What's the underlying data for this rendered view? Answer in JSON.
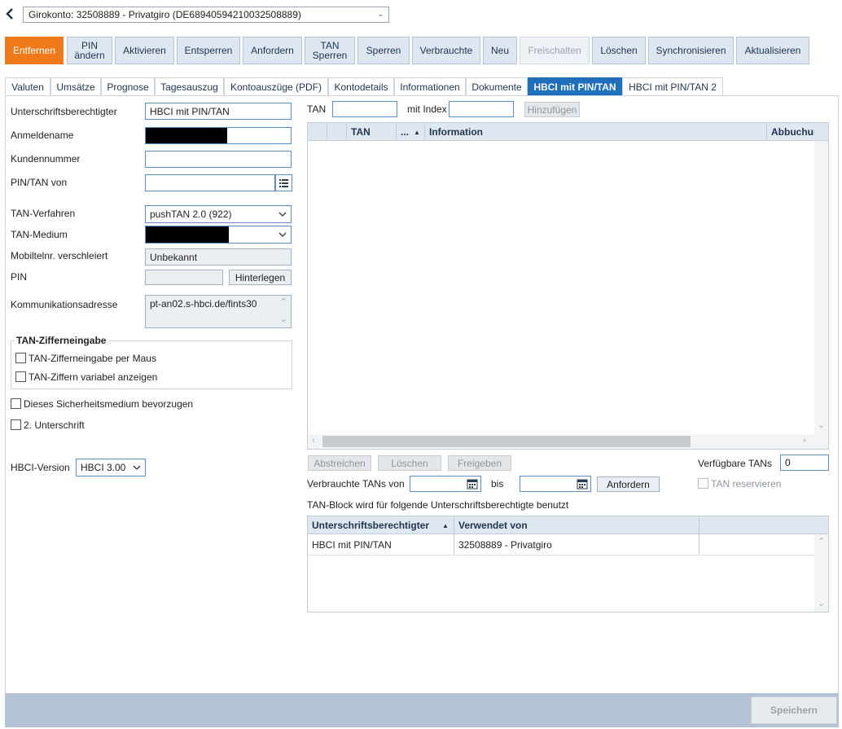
{
  "account_select": {
    "value": "Girokonto: 32508889 - Privatgiro (DE68940594210032508889)"
  },
  "toolbar": {
    "entfernen": "Entfernen",
    "pin_aendern_1": "PIN",
    "pin_aendern_2": "ändern",
    "aktivieren": "Aktivieren",
    "entsperren": "Entsperren",
    "anfordern": "Anfordern",
    "tan_sperren_1": "TAN",
    "tan_sperren_2": "Sperren",
    "sperren": "Sperren",
    "verbrauchte": "Verbrauchte",
    "neu": "Neu",
    "freischalten": "Freischalten",
    "loeschen": "Löschen",
    "synchronisieren": "Synchronisieren",
    "aktualisieren": "Aktualisieren"
  },
  "tabs": [
    "Valuten",
    "Umsätze",
    "Prognose",
    "Tagesauszug",
    "Kontoauszüge (PDF)",
    "Kontodetails",
    "Informationen",
    "Dokumente",
    "HBCI mit PIN/TAN",
    "HBCI mit PIN/TAN 2"
  ],
  "form": {
    "unterschrift_label": "Unterschriftsberechtigter",
    "unterschrift_value": "HBCI mit PIN/TAN",
    "anmeldename_label": "Anmeldename",
    "kundennummer_label": "Kundennummer",
    "pintan_von_label": "PIN/TAN von",
    "tan_verfahren_label": "TAN-Verfahren",
    "tan_verfahren_value": "pushTAN 2.0 (922)",
    "tan_medium_label": "TAN-Medium",
    "mobil_label": "Mobiltelnr. verschleiert",
    "mobil_value": "Unbekannt",
    "pin_label": "PIN",
    "hinterlegen": "Hinterlegen",
    "komm_label": "Kommunikationsadresse",
    "komm_value": "pt-an02.s-hbci.de/fints30",
    "ziffer_group": "TAN-Zifferneingabe",
    "ziffer_maus": "TAN-Zifferneingabe per Maus",
    "ziffer_variabel": "TAN-Ziffern variabel anzeigen",
    "bevorzugen": "Dieses Sicherheitsmedium bevorzugen",
    "unterschrift2": "2. Unterschrift",
    "hbci_version_label": "HBCI-Version",
    "hbci_version_value": "HBCI 3.00"
  },
  "tan_panel": {
    "tan_label": "TAN",
    "mit_index_label": "mit Index",
    "hinzufuegen": "Hinzufügen",
    "columns": [
      "TAN",
      "...",
      "Information",
      "Abbuchun"
    ],
    "abstreichen": "Abstreichen",
    "loeschen": "Löschen",
    "freigeben": "Freigeben",
    "verfuegbare_label": "Verfügbare TANs",
    "verfuegbare_value": "0",
    "verbrauchte_von_label": "Verbrauchte TANs von",
    "bis_label": "bis",
    "anfordern": "Anfordern",
    "tan_reservieren": "TAN reservieren",
    "block_info": "TAN-Block wird für folgende Unterschriftsberechtigte benutzt"
  },
  "block_table": {
    "columns": [
      "Unterschriftsberechtigter",
      "Verwendet von"
    ],
    "rows": [
      [
        "HBCI mit PIN/TAN",
        "32508889 - Privatgiro"
      ]
    ]
  },
  "footer": {
    "speichern": "Speichern"
  }
}
